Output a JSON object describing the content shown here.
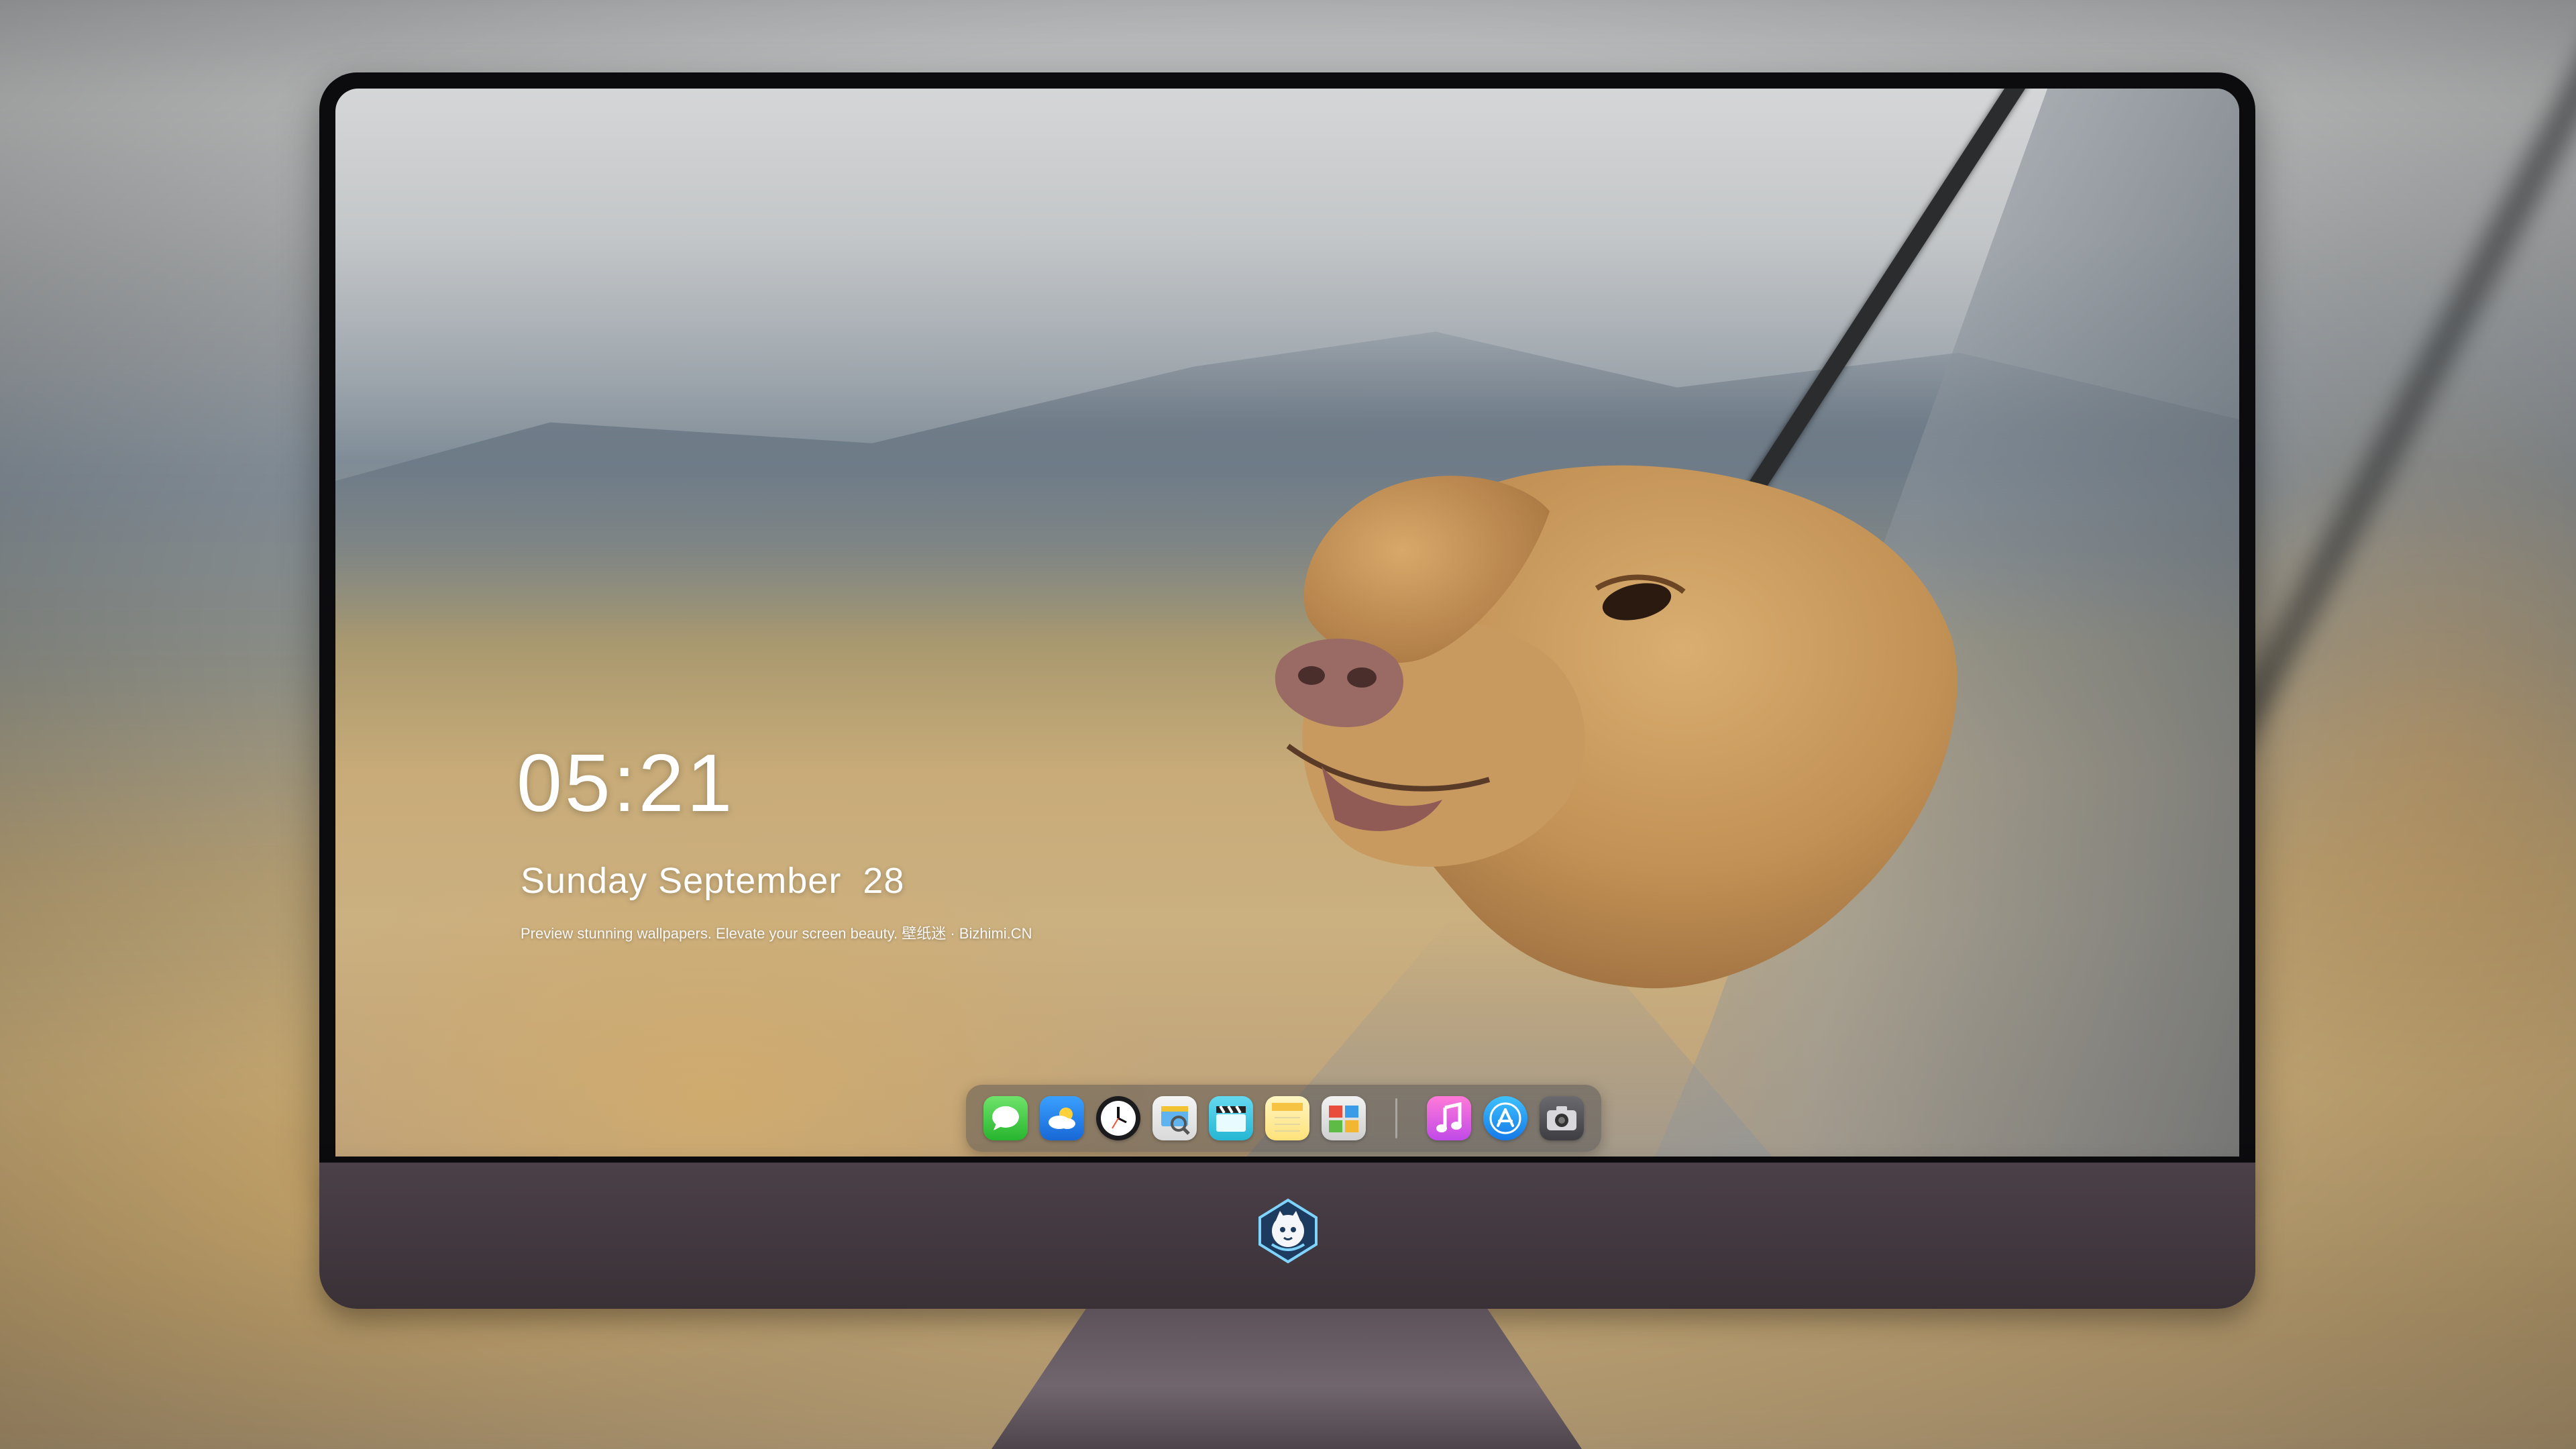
{
  "lockscreen": {
    "time": "05:21",
    "date": "Sunday September  28",
    "tagline": "Preview stunning wallpapers. Elevate your screen beauty. 壁纸迷 · Bizhimi.CN"
  },
  "dock": {
    "apps": [
      {
        "name": "Messages",
        "icon": "messages-icon"
      },
      {
        "name": "Weather",
        "icon": "weather-icon"
      },
      {
        "name": "Clock",
        "icon": "clock-icon"
      },
      {
        "name": "Preview",
        "icon": "preview-icon"
      },
      {
        "name": "Clips",
        "icon": "clapperboard-icon"
      },
      {
        "name": "Notes",
        "icon": "notes-icon"
      },
      {
        "name": "Photo Booth",
        "icon": "photo-booth-icon"
      },
      {
        "name": "Music",
        "icon": "music-icon"
      },
      {
        "name": "App Store",
        "icon": "app-store-icon"
      },
      {
        "name": "Camera",
        "icon": "camera-icon"
      }
    ]
  },
  "colors": {
    "monitor_bezel": "#0c0c0e",
    "monitor_chin": "#41373e",
    "text": "#ffffff"
  }
}
